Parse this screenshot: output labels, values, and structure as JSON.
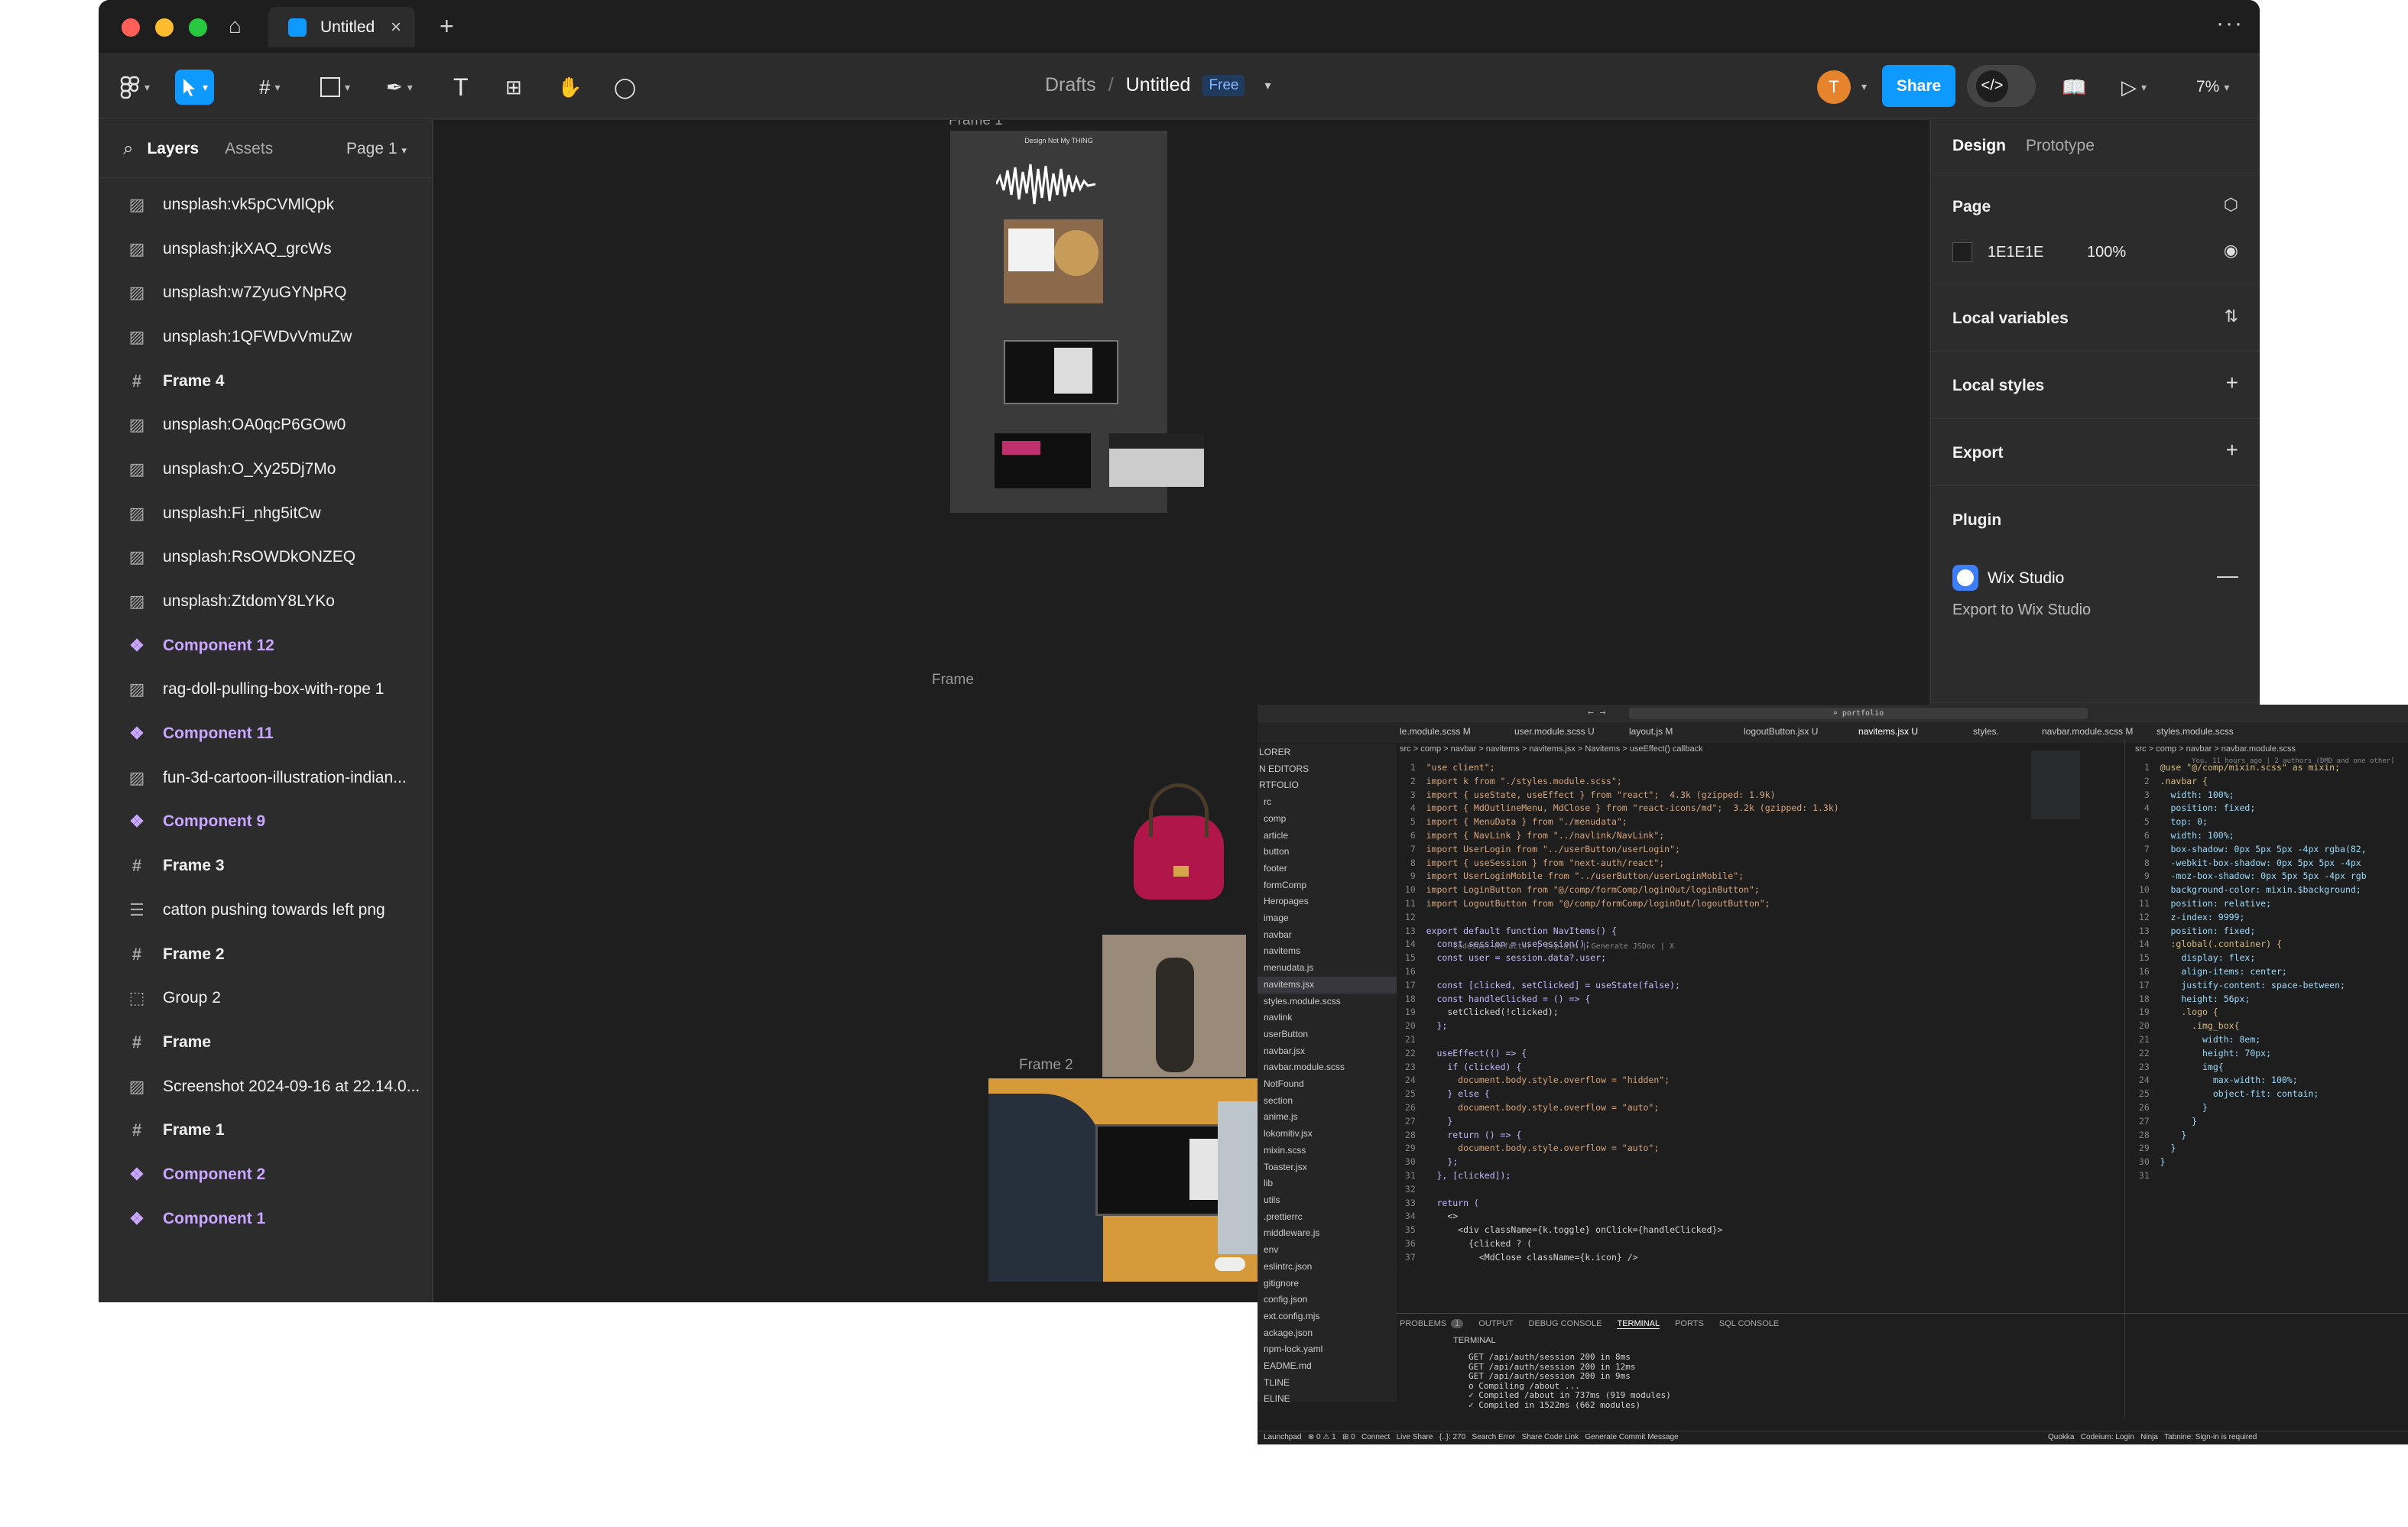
{
  "tab": {
    "title": "Untitled"
  },
  "toolbar": {
    "breadcrumb_drafts": "Drafts",
    "breadcrumb_sep": "/",
    "file_name": "Untitled",
    "plan_badge": "Free",
    "avatar_initial": "T",
    "share_label": "Share",
    "zoom": "7%"
  },
  "left_panel": {
    "tab_layers": "Layers",
    "tab_assets": "Assets",
    "page_selector": "Page 1",
    "layers": [
      {
        "type": "image",
        "label": "unsplash:vk5pCVMlQpk"
      },
      {
        "type": "image",
        "label": "unsplash:jkXAQ_grcWs"
      },
      {
        "type": "image",
        "label": "unsplash:w7ZyuGYNpRQ"
      },
      {
        "type": "image",
        "label": "unsplash:1QFWDvVmuZw"
      },
      {
        "type": "frame",
        "label": "Frame 4"
      },
      {
        "type": "image",
        "label": "unsplash:OA0qcP6GOw0"
      },
      {
        "type": "image",
        "label": "unsplash:O_Xy25Dj7Mo"
      },
      {
        "type": "image",
        "label": "unsplash:Fi_nhg5itCw"
      },
      {
        "type": "image",
        "label": "unsplash:RsOWDkONZEQ"
      },
      {
        "type": "image",
        "label": "unsplash:ZtdomY8LYKo"
      },
      {
        "type": "component",
        "label": "Component 12"
      },
      {
        "type": "image",
        "label": "rag-doll-pulling-box-with-rope 1"
      },
      {
        "type": "component",
        "label": "Component 11"
      },
      {
        "type": "image",
        "label": "fun-3d-cartoon-illustration-indian..."
      },
      {
        "type": "component",
        "label": "Component 9"
      },
      {
        "type": "frame",
        "label": "Frame 3"
      },
      {
        "type": "text",
        "label": "catton pushing towards left png"
      },
      {
        "type": "frame",
        "label": "Frame 2"
      },
      {
        "type": "group",
        "label": "Group 2"
      },
      {
        "type": "frame",
        "label": "Frame"
      },
      {
        "type": "image",
        "label": "Screenshot 2024-09-16 at 22.14.0..."
      },
      {
        "type": "frame",
        "label": "Frame 1"
      },
      {
        "type": "component",
        "label": "Component 2"
      },
      {
        "type": "component",
        "label": "Component 1"
      }
    ]
  },
  "canvas": {
    "frame1_label": "Frame 1",
    "frame1_heading": "Design Not My THING",
    "frame_label": "Frame",
    "frame2_label": "Frame 2"
  },
  "right_panel": {
    "tab_design": "Design",
    "tab_prototype": "Prototype",
    "page_title": "Page",
    "page_color": "1E1E1E",
    "page_opacity": "100%",
    "local_variables": "Local variables",
    "local_styles": "Local styles",
    "export": "Export",
    "plugin": "Plugin",
    "plugin_name": "Wix Studio",
    "plugin_action": "Export to Wix Studio"
  },
  "vscode": {
    "search": "portfolio",
    "tabs": [
      "le.module.scss M",
      "user.module.scss U",
      "layout.js M",
      "logoutButton.jsx U",
      "navitems.jsx U",
      "styles.",
      "navbar.module.scss M",
      "styles.module.scss"
    ],
    "breadcrumb": "src > comp > navbar > navitems > navitems.jsx > Navitems > useEffect() callback",
    "breadcrumb2": "src > comp > navbar > navbar.module.scss",
    "explorer": [
      "LORER",
      "N EDITORS",
      "RTFOLIO",
      "rc",
      "comp",
      "article",
      "button",
      "footer",
      "formComp",
      "Heropages",
      "image",
      "navbar",
      "navitems",
      "menudata.js",
      "navitems.jsx",
      "styles.module.scss",
      "navlink",
      "userButton",
      "navbar.jsx",
      "navbar.module.scss",
      "NotFound",
      "section",
      "anime.js",
      "lokomitiv.jsx",
      "mixin.scss",
      "Toaster.jsx",
      "lib",
      "utils",
      ".prettierrc",
      "middleware.js",
      "env",
      "eslintrc.json",
      "gitignore",
      "config.json",
      "ext.config.mjs",
      "ackage.json",
      "npm-lock.yaml",
      "EADME.md",
      "TLINE",
      "ELINE"
    ],
    "code_lines": [
      "\"use client\";",
      "import k from \"./styles.module.scss\";",
      "import { useState, useEffect } from \"react\";  4.3k (gzipped: 1.9k)",
      "import { MdOutlineMenu, MdClose } from \"react-icons/md\";  3.2k (gzipped: 1.3k)",
      "import { MenuData } from \"./menudata\";",
      "import { NavLink } from \"../navlink/NavLink\";",
      "import UserLogin from \"../userButton/userLogin\";",
      "import { useSession } from \"next-auth/react\";",
      "import UserLoginMobile from \"../userButton/userLoginMobile\";",
      "import LoginButton from \"@/comp/formComp/loginOut/loginButton\";",
      "import LogoutButton from \"@/comp/formComp/loginOut/logoutButton\";",
      "",
      "export default function NavItems() {",
      "  const session = useSession();",
      "  const user = session.data?.user;",
      "",
      "  const [clicked, setClicked] = useState(false);",
      "  const handleClicked = () => {",
      "    setClicked(!clicked);",
      "  };",
      "",
      "  useEffect(() => {",
      "    if (clicked) {",
      "      document.body.style.overflow = \"hidden\";",
      "    } else {",
      "      document.body.style.overflow = \"auto\";",
      "    }",
      "    return () => {",
      "      document.body.style.overflow = \"auto\";",
      "    };",
      "  }, [clicked]);",
      "",
      "  return (",
      "    <>",
      "      <div className={k.toggle} onClick={handleClicked}>",
      "        {clicked ? (",
      "          <MdClose className={k.icon} />"
    ],
    "scss_lines": [
      "@use \"@/comp/mixin.scss\" as mixin;",
      ".navbar {",
      "  width: 100%;",
      "  position: fixed;",
      "  top: 0;",
      "  width: 100%;",
      "  box-shadow: 0px 5px 5px -4px rgba(82,",
      "  -webkit-box-shadow: 0px 5px 5px -4px",
      "  -moz-box-shadow: 0px 5px 5px -4px rgb",
      "  background-color: mixin.$background;",
      "  position: relative;",
      "  z-index: 9999;",
      "  position: fixed;",
      "  :global(.container) {",
      "    display: flex;",
      "    align-items: center;",
      "    justify-content: space-between;",
      "    height: 56px;",
      "    .logo {",
      "      .img_box{",
      "        width: 8em;",
      "        height: 70px;",
      "        img{",
      "          max-width: 100%;",
      "          object-fit: contain;",
      "        }",
      "      }",
      "    }",
      "  }",
      "}",
      ""
    ],
    "panel_tabs": [
      "PROBLEMS",
      "OUTPUT",
      "DEBUG CONSOLE",
      "TERMINAL",
      "PORTS",
      "SQL CONSOLE"
    ],
    "problems_count": "1",
    "terminal_header": "TERMINAL",
    "terminal_lines": [
      "GET /api/auth/session 200 in 8ms",
      "GET /api/auth/session 200 in 12ms",
      "GET /api/auth/session 200 in 9ms",
      "o Compiling /about ...",
      "✓ Compiled /about in 737ms (919 modules)",
      "✓ Compiled in 1522ms (662 modules)"
    ],
    "status_left": "Launchpad   ⊗ 0 ⚠ 1   ⊞ 0   Connect   Live Share   {..}: 270   Search Error   Share Code Link   Generate Commit Message",
    "status_right": "Quokka   Codeium: Login   Ninja   Tabnine: Sign-in is required",
    "codeium_hint": "Codeium: Refactor | Explain | Generate JSDoc | X",
    "git_hint": "You, 11 hours ago | 2 authors (DMD and one other)"
  }
}
